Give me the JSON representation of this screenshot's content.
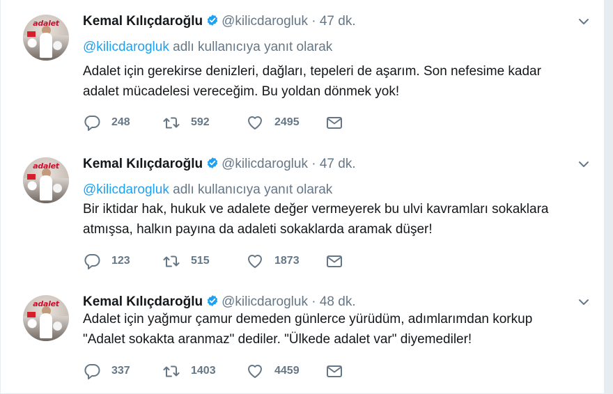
{
  "tweets": [
    {
      "name": "Kemal Kılıçdaroğlu",
      "handle": "@kilicdarogluk",
      "dot": "·",
      "time": "47 dk.",
      "reply_mention": "@kilicdarogluk",
      "reply_text": " adlı kullanıcıya yanıt olarak",
      "text_lines": [
        "Adalet için gerekirse denizleri, dağları, tepeleri de aşarım. Son nefesime kadar",
        "adalet mücadelesi vereceğim. Bu yoldan dönmek yok!"
      ],
      "replies": "248",
      "retweets": "592",
      "likes": "2495"
    },
    {
      "name": "Kemal Kılıçdaroğlu",
      "handle": "@kilicdarogluk",
      "dot": "·",
      "time": "47 dk.",
      "reply_mention": "@kilicdarogluk",
      "reply_text": " adlı kullanıcıya yanıt olarak",
      "text_lines": [
        "Bir iktidar hak, hukuk ve adalete değer vermeyerek bu ulvi kavramları sokaklara",
        "atmışsa, halkın payına da adaleti sokaklarda aramak düşer!"
      ],
      "replies": "123",
      "retweets": "515",
      "likes": "1873"
    },
    {
      "name": "Kemal Kılıçdaroğlu",
      "handle": "@kilicdarogluk",
      "dot": "·",
      "time": "48 dk.",
      "text_lines": [
        "Adalet için yağmur çamur demeden günlerce yürüdüm, adımlarımdan korkup",
        "\"Adalet sokakta aranmaz\" dediler. \"Ülkede adalet var\" diyemediler!"
      ],
      "replies": "337",
      "retweets": "1403",
      "likes": "4459"
    }
  ],
  "avatar_brand": "adalet",
  "icons": {
    "verified": "verified-badge-icon",
    "caret": "chevron-down-icon",
    "reply": "reply-icon",
    "retweet": "retweet-icon",
    "like": "heart-icon",
    "dm": "envelope-icon"
  },
  "colors": {
    "link": "#1da1f2",
    "muted": "#657786",
    "text": "#14171a",
    "divider": "#e6ecf0"
  }
}
